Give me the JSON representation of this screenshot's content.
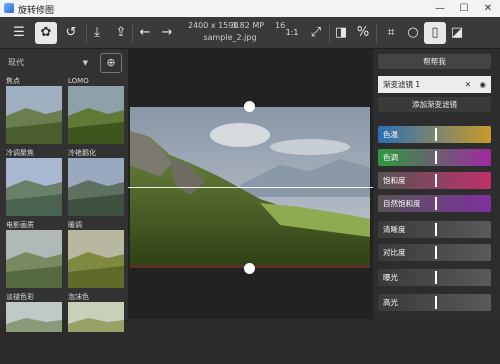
{
  "window": {
    "title": "旋转修图",
    "minimize": "—",
    "maximize": "☐",
    "close": "✕"
  },
  "toolbar": {
    "icons": [
      "menu-icon",
      "filters-icon",
      "history-icon",
      "save-icon",
      "share-icon",
      "undo-icon",
      "redo-icon",
      "fit-icon",
      "compare-icon",
      "crop-icon",
      "circle-icon",
      "rect-icon",
      "mask-icon"
    ],
    "image_size": "2400 x 1590",
    "megapixels": "3.82 MP",
    "bit_depth": "16",
    "file_name": "sample_2.jpg",
    "zoom": "1:1"
  },
  "left_panel": {
    "category": "现代",
    "presets": [
      {
        "label": "焦点",
        "tint": "#7a8a6a"
      },
      {
        "label": "LOMO",
        "tint": "#5a6a4a"
      },
      {
        "label": "冷调聚焦",
        "tint": "#6a7a9a"
      },
      {
        "label": "冷艳鹅化",
        "tint": "#5a6a8a"
      },
      {
        "label": "电影画质",
        "tint": "#7a8a7a"
      },
      {
        "label": "暖调",
        "tint": "#8a8a5a"
      },
      {
        "label": "淡褪色彩",
        "tint": "#8a9a8a"
      },
      {
        "label": "泡沫色",
        "tint": "#9aa27a"
      }
    ]
  },
  "right_panel": {
    "help": "帮帮我",
    "filter_name": "渐变滤镜 1",
    "add_filter": "添加渐变滤镜",
    "sliders": [
      {
        "label": "色温",
        "value": 0.5,
        "from": "#2c6fb5",
        "to": "#c99a2a"
      },
      {
        "label": "色调",
        "value": 0.5,
        "from": "#2e9a3e",
        "to": "#a02aa0"
      },
      {
        "label": "饱和度",
        "value": 0.5,
        "from": "#555555",
        "to": "#c0306a"
      },
      {
        "label": "自然饱和度",
        "value": 0.5,
        "from": "#555555",
        "to": "#8030a0"
      },
      {
        "label": "清晰度",
        "value": 0.5,
        "from": "#3a3a3a",
        "to": "#5a5a5a"
      },
      {
        "label": "对比度",
        "value": 0.5,
        "from": "#3a3a3a",
        "to": "#5a5a5a"
      },
      {
        "label": "曝光",
        "value": 0.5,
        "from": "#3a3a3a",
        "to": "#5a5a5a"
      },
      {
        "label": "高光",
        "value": 0.5,
        "from": "#3a3a3a",
        "to": "#5a5a5a"
      }
    ]
  }
}
